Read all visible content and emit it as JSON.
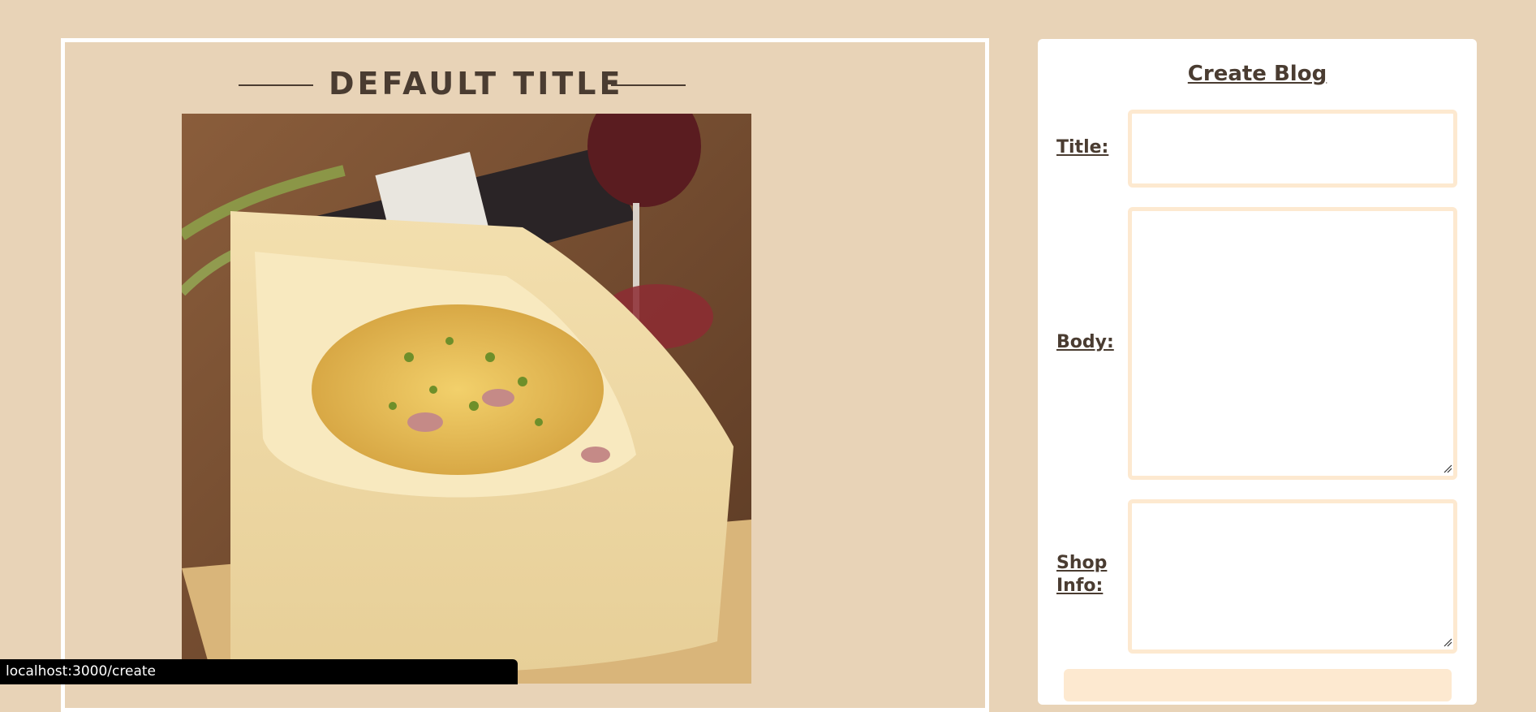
{
  "preview": {
    "title": "DEFAULT TITLE",
    "photo_name": "pasta-in-cheese-wheel-photo"
  },
  "form": {
    "heading": "Create Blog",
    "title_label": "Title:",
    "title_value": "",
    "body_label": "Body:",
    "body_value": "",
    "shop_label_line1": "Shop",
    "shop_label_line2": "Info:",
    "shop_value": "",
    "submit_label": ""
  },
  "status_bar": {
    "url": "localhost:3000/create"
  },
  "colors": {
    "page_background": "#e8d3b7",
    "text": "#4a3c31",
    "field_border": "#fde9d0",
    "card": "#ffffff"
  }
}
